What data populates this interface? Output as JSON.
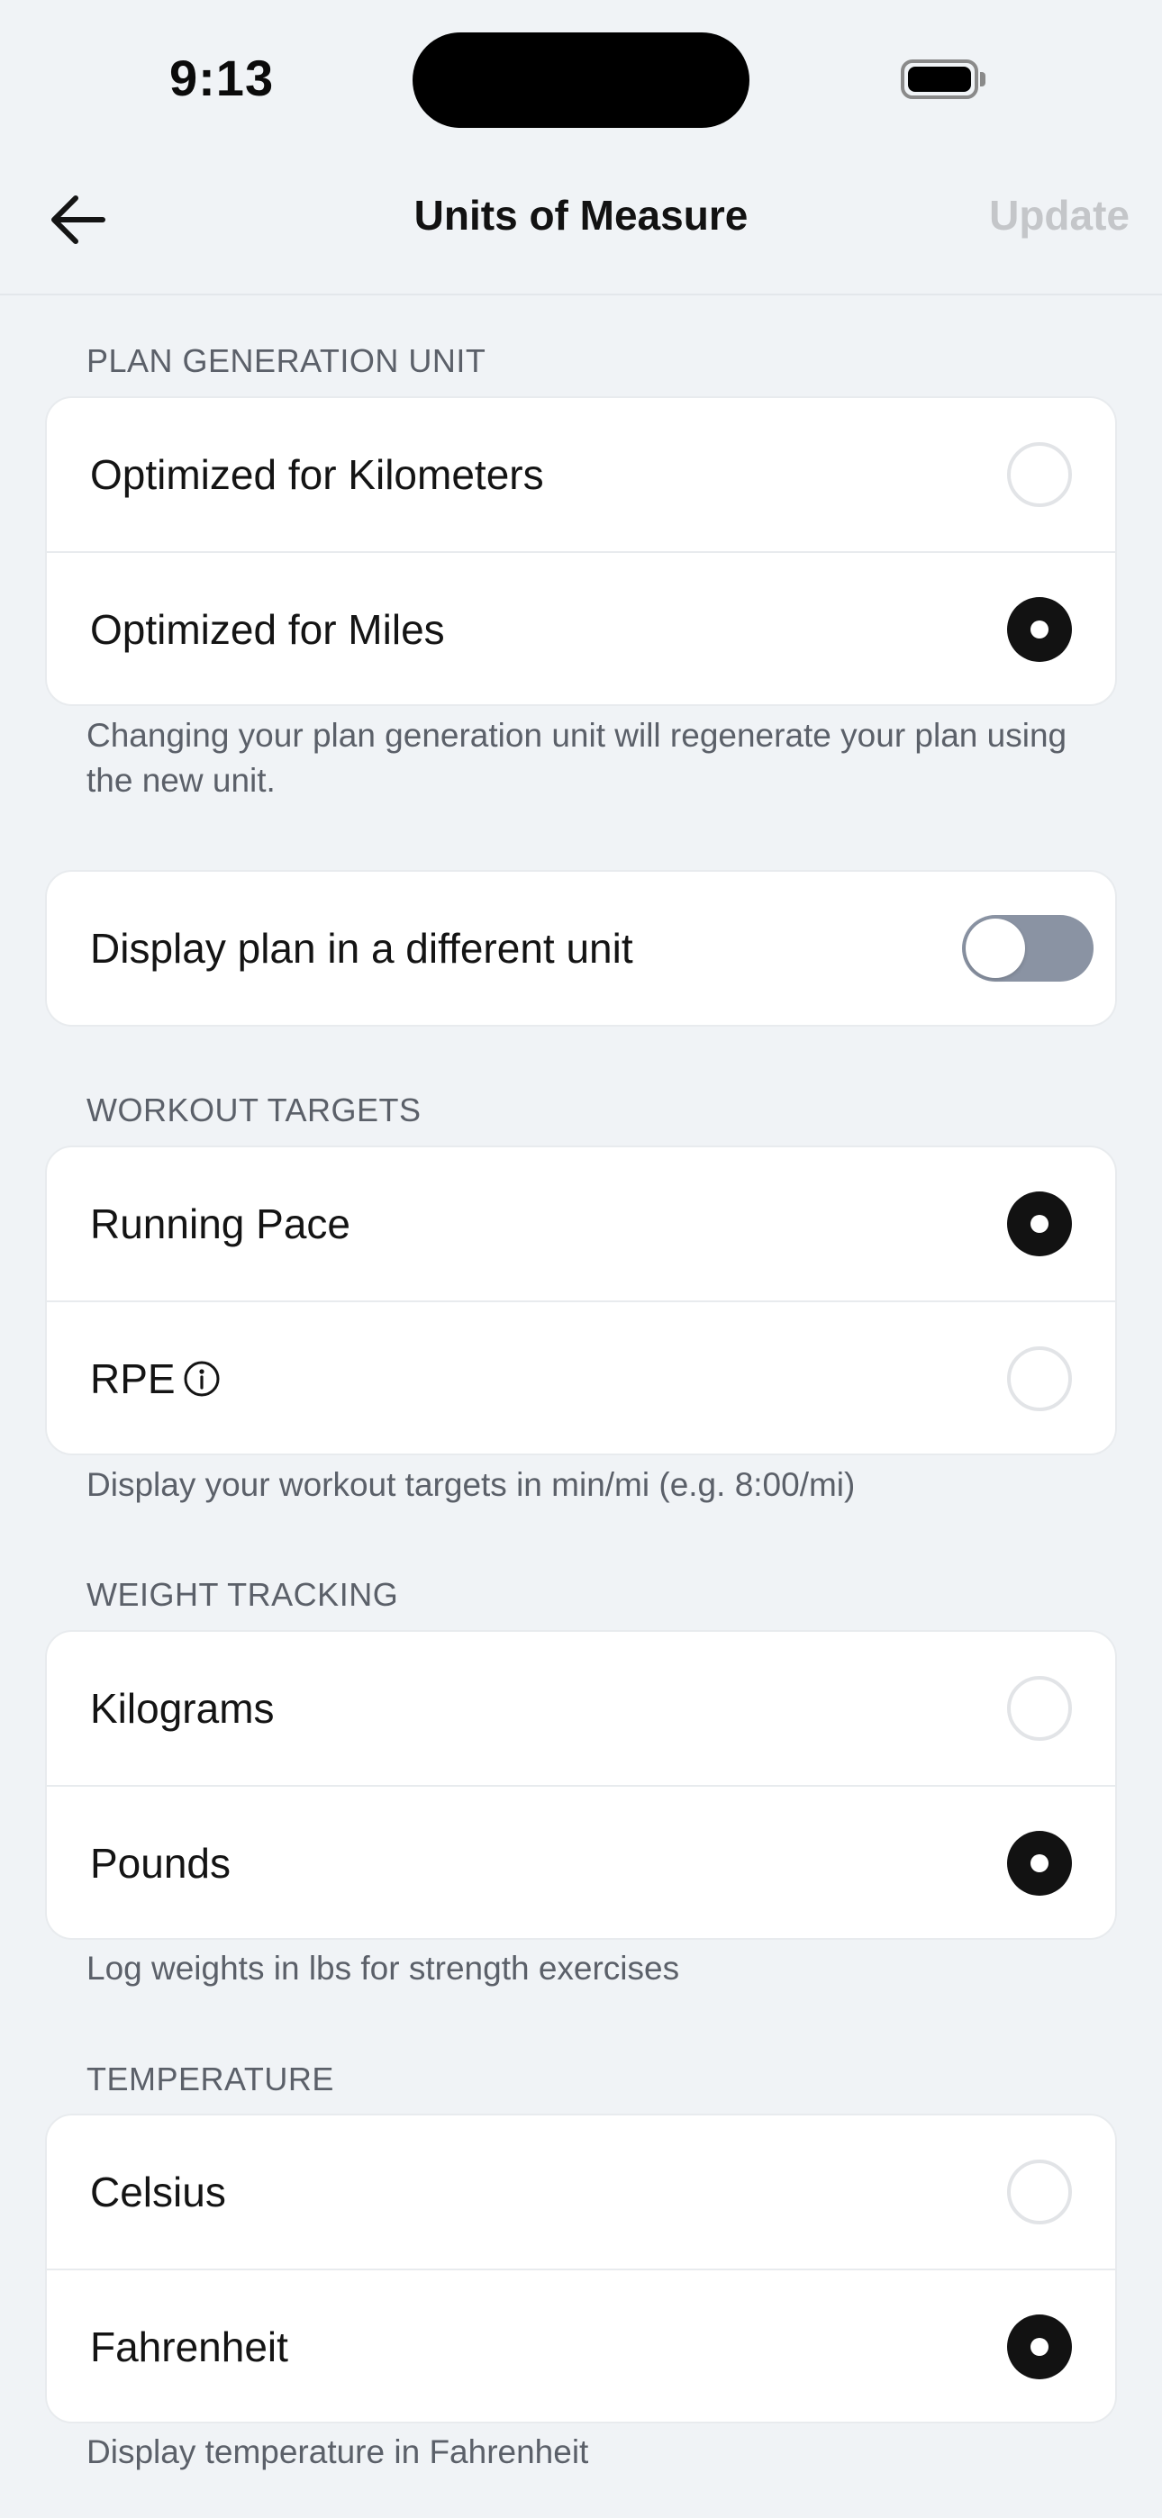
{
  "status_bar": {
    "time": "9:13"
  },
  "nav": {
    "title": "Units of Measure",
    "update_label": "Update"
  },
  "plan_generation": {
    "header": "PLAN GENERATION UNIT",
    "options": [
      {
        "label": "Optimized for Kilometers",
        "selected": false
      },
      {
        "label": "Optimized for Miles",
        "selected": true
      }
    ],
    "footnote": "Changing your plan generation unit will regenerate your plan using the new unit."
  },
  "display_unit": {
    "label": "Display plan in a different unit",
    "enabled": false
  },
  "workout_targets": {
    "header": "WORKOUT TARGETS",
    "options": [
      {
        "label": "Running Pace",
        "selected": true
      },
      {
        "label": "RPE",
        "selected": false,
        "icon": "info-icon"
      }
    ],
    "footnote": "Display your workout targets in min/mi (e.g. 8:00/mi)"
  },
  "weight_tracking": {
    "header": "WEIGHT TRACKING",
    "options": [
      {
        "label": "Kilograms",
        "selected": false
      },
      {
        "label": "Pounds",
        "selected": true
      }
    ],
    "footnote": "Log weights in lbs for strength exercises"
  },
  "temperature": {
    "header": "TEMPERATURE",
    "options": [
      {
        "label": "Celsius",
        "selected": false
      },
      {
        "label": "Fahrenheit",
        "selected": true
      }
    ],
    "footnote": "Display temperature in Fahrenheit"
  },
  "colors": {
    "background": "#f0f3f6",
    "selected_radio": "#121212",
    "toggle_off": "#8a93a3",
    "update_disabled": "#c4c6c9",
    "secondary_text": "#5b6069"
  }
}
